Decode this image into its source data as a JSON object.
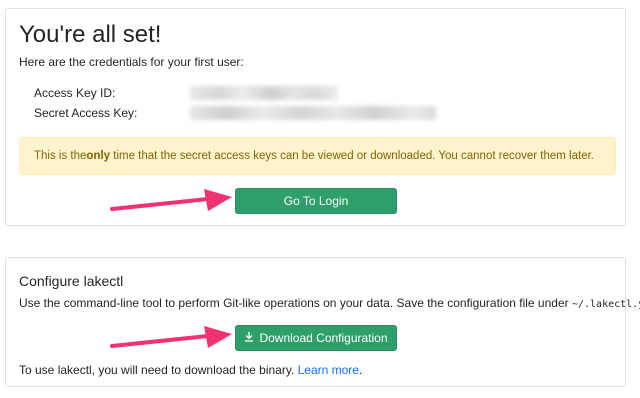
{
  "credentials_card": {
    "title": "You're all set!",
    "subtitle": "Here are the credentials for your first user:",
    "access_key_label": "Access Key ID:",
    "secret_key_label": "Secret Access Key:",
    "alert_before": "This is the ",
    "alert_bold": "only",
    "alert_after": " time that the secret access keys can be viewed or downloaded. You cannot recover them later.",
    "login_button": "Go To Login"
  },
  "lakectl_card": {
    "title": "Configure lakectl",
    "description_before": "Use the command-line tool to perform Git-like operations on your data. Save the configuration file under ",
    "description_code": "~/.lakectl.yaml",
    "description_after": ":",
    "download_button": "Download Configuration",
    "download_icon": "download-icon",
    "footer_before": "To use lakectl, you will need to download the binary. ",
    "footer_link": "Learn more",
    "footer_after": "."
  },
  "colors": {
    "button_green": "#2e9e6b",
    "alert_bg": "#fff3cd",
    "alert_text": "#856404",
    "arrow": "#f0326e",
    "link": "#0d6efd"
  }
}
